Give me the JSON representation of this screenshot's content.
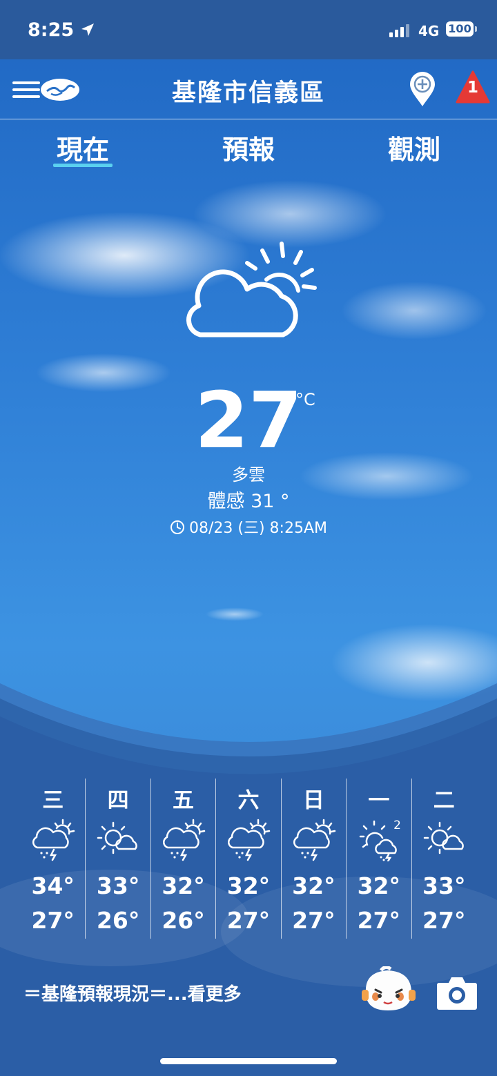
{
  "status": {
    "time": "8:25",
    "network": "4G",
    "battery": "100"
  },
  "header": {
    "title": "基隆市信義區",
    "alert_count": "1"
  },
  "tabs": [
    {
      "label": "現在",
      "active": true
    },
    {
      "label": "預報",
      "active": false
    },
    {
      "label": "觀測",
      "active": false
    }
  ],
  "current": {
    "icon": "partly-cloudy-icon",
    "temperature": "27",
    "unit": "°C",
    "condition": "多雲",
    "feels_like": "體感 31 °",
    "observed": "08/23 (三) 8:25AM"
  },
  "forecast": [
    {
      "day": "三",
      "icon": "thunderstorm-sun-icon",
      "high": "34°",
      "low": "27°"
    },
    {
      "day": "四",
      "icon": "sun-cloud-icon",
      "high": "33°",
      "low": "26°"
    },
    {
      "day": "五",
      "icon": "thunderstorm-sun-icon",
      "high": "32°",
      "low": "26°"
    },
    {
      "day": "六",
      "icon": "thunderstorm-sun-icon",
      "high": "32°",
      "low": "27°"
    },
    {
      "day": "日",
      "icon": "thunderstorm-sun-icon",
      "high": "32°",
      "low": "27°"
    },
    {
      "day": "一",
      "icon": "sun-thunder-cloud-icon",
      "high": "32°",
      "low": "27°",
      "badge": "2"
    },
    {
      "day": "二",
      "icon": "sun-cloud-icon",
      "high": "33°",
      "low": "27°"
    }
  ],
  "footer": {
    "news_text": "＝基隆預報現況＝...看更多"
  },
  "colors": {
    "accent": "#5ad0f0",
    "alert": "#e53935",
    "statusbar": "#2a5a9c"
  }
}
